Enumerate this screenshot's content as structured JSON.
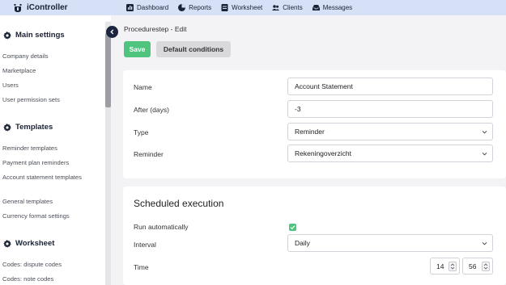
{
  "app": {
    "name": "iController"
  },
  "topnav": [
    {
      "label": "Dashboard",
      "icon": "dashboard-icon"
    },
    {
      "label": "Reports",
      "icon": "pie-chart-icon"
    },
    {
      "label": "Worksheet",
      "icon": "worksheet-icon"
    },
    {
      "label": "Clients",
      "icon": "users-icon"
    },
    {
      "label": "Messages",
      "icon": "inbox-icon"
    }
  ],
  "sidebar": {
    "sections": [
      {
        "title": "Main settings",
        "icon": "gear-icon",
        "items": [
          "Company details",
          "Marketplace",
          "Users",
          "User permission sets"
        ]
      },
      {
        "title": "Templates",
        "icon": "gear-icon",
        "items": [
          "Reminder templates",
          "Payment plan reminders",
          "Account statement templates",
          "General templates",
          "Currency format settings"
        ]
      },
      {
        "title": "Worksheet",
        "icon": "gear-icon",
        "items": [
          "Codes: dispute codes",
          "Codes: note codes"
        ]
      }
    ]
  },
  "page": {
    "title": "Procedurestep - Edit",
    "save_label": "Save",
    "default_conditions_label": "Default conditions"
  },
  "form": {
    "name_label": "Name",
    "name_value": "Account Statement",
    "after_label": "After (days)",
    "after_value": "-3",
    "type_label": "Type",
    "type_value": "Reminder",
    "reminder_label": "Reminder",
    "reminder_value": "Rekeningoverzicht"
  },
  "schedule": {
    "title": "Scheduled execution",
    "run_auto_label": "Run automatically",
    "run_auto_checked": true,
    "interval_label": "Interval",
    "interval_value": "Daily",
    "time_label": "Time",
    "time_hour": "14",
    "time_minute": "56"
  },
  "colors": {
    "topbar": "#d6e1f7",
    "save_green": "#4fc47e",
    "collapse_dark": "#1c2540"
  }
}
